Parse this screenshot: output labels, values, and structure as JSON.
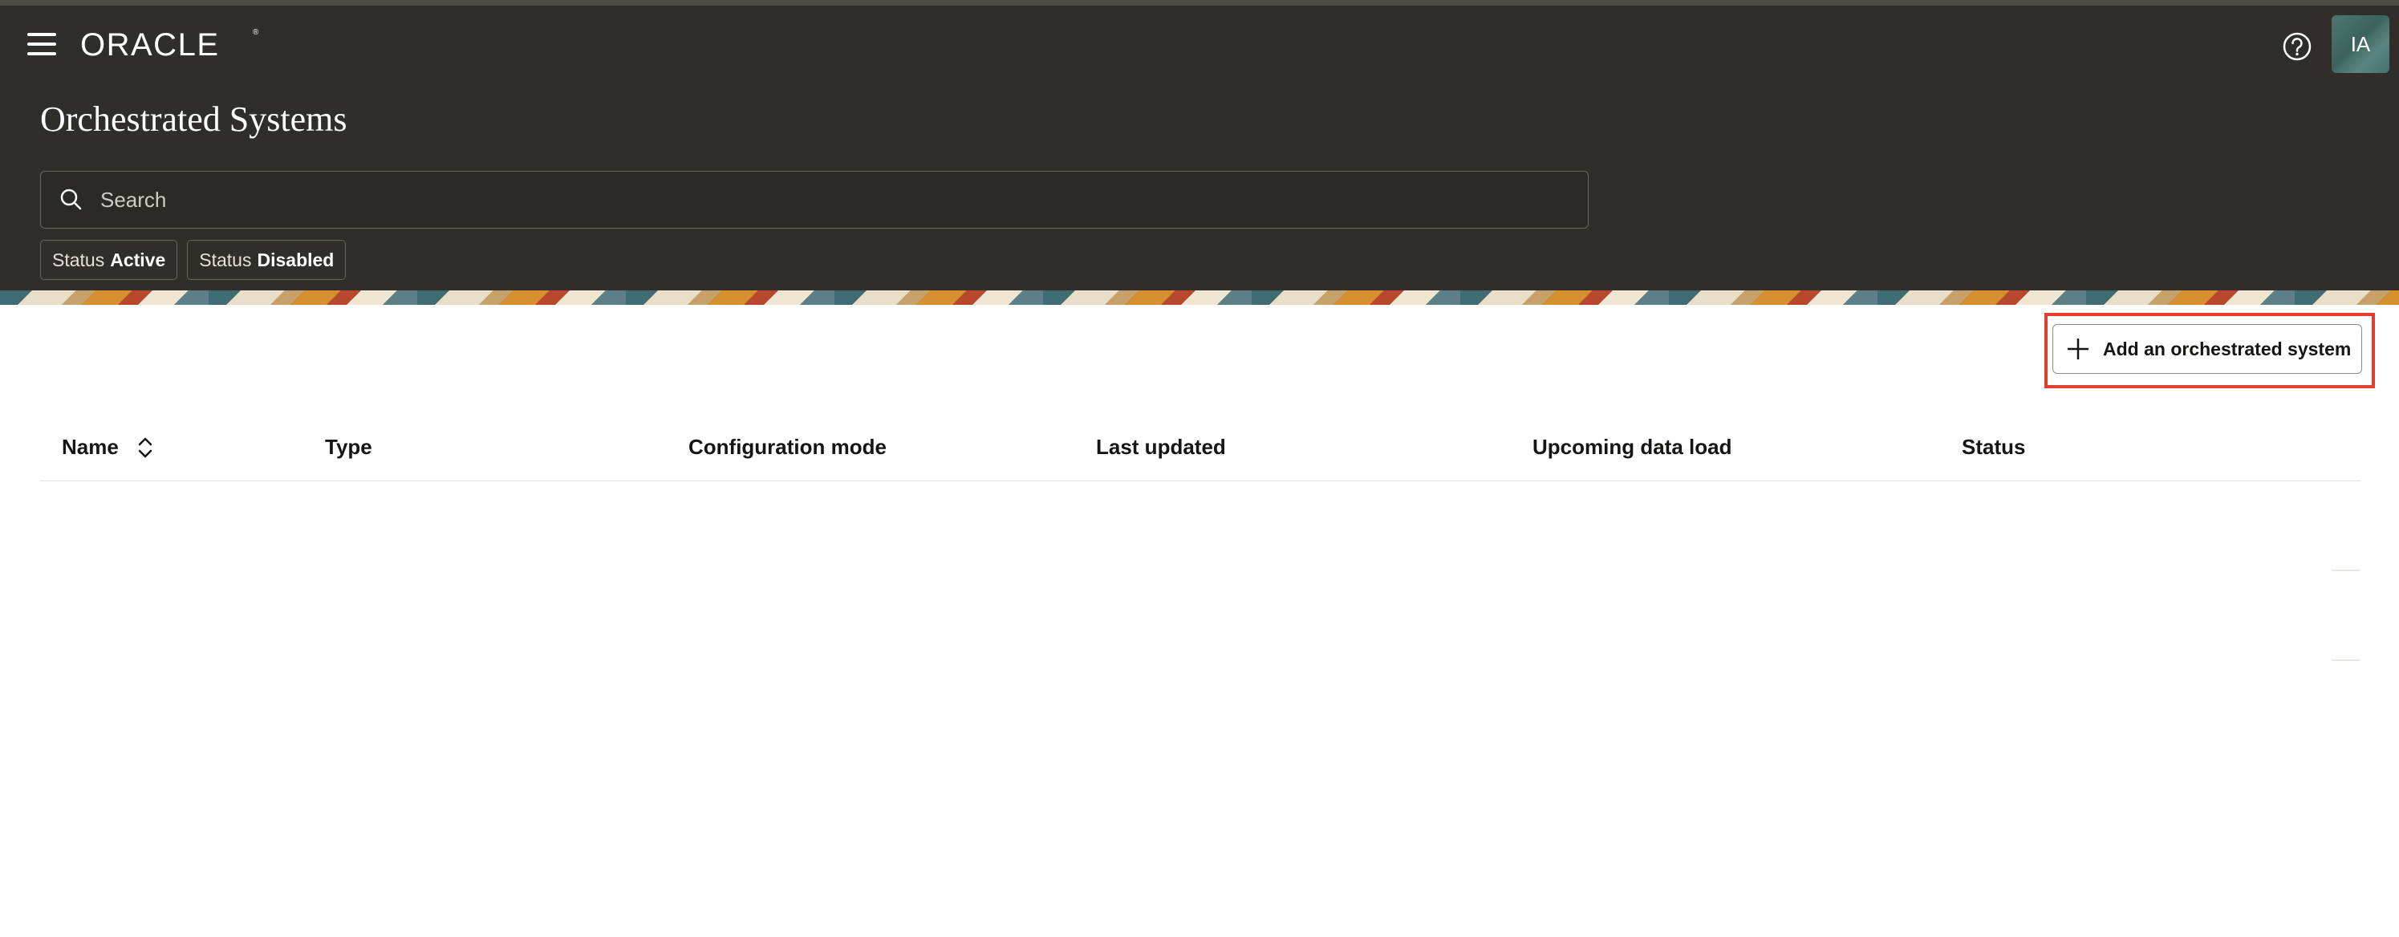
{
  "header": {
    "brand": "ORACLE",
    "page_title": "Orchestrated Systems",
    "avatar_initials": "IA",
    "search": {
      "placeholder": "Search",
      "value": ""
    },
    "filters": [
      {
        "label": "Status",
        "value": "Active"
      },
      {
        "label": "Status",
        "value": "Disabled"
      }
    ]
  },
  "toolbar": {
    "add_label": "Add an orchestrated system"
  },
  "table": {
    "columns": [
      "Name",
      "Type",
      "Configuration mode",
      "Last updated",
      "Upcoming data load",
      "Status"
    ],
    "rows": []
  },
  "icons": {
    "menu": "hamburger-icon",
    "help": "help-circle-icon",
    "search": "search-icon",
    "add": "plus-icon",
    "sort": "sort-icon"
  },
  "colors": {
    "header_bg": "#312d2a",
    "highlight": "#e0412c",
    "avatar_bg": "#4e7671"
  }
}
